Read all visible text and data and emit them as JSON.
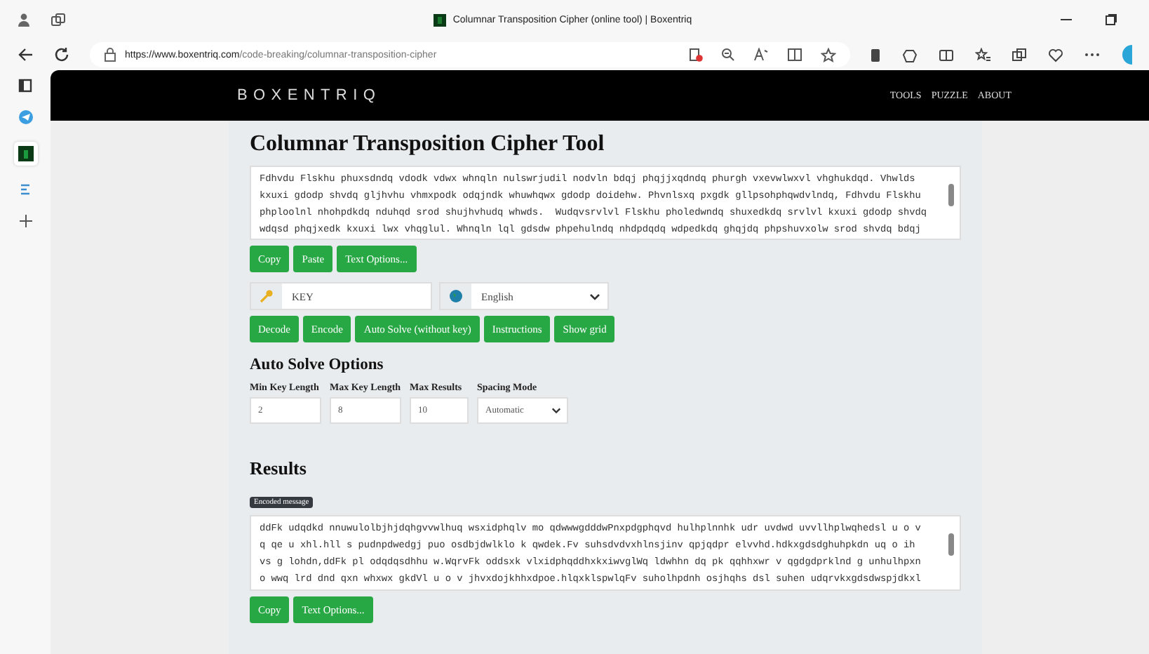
{
  "browser": {
    "tab_title": "Columnar Transposition Cipher (online tool) | Boxentriq",
    "url_host": "https://www.boxentriq.com",
    "url_path": "/code-breaking/columnar-transposition-cipher"
  },
  "header": {
    "logo": "BOXENTRIQ",
    "nav": [
      "TOOLS",
      "PUZZLE",
      "ABOUT"
    ]
  },
  "title": "Columnar Transposition Cipher Tool",
  "input_lines": [
    "Fdhvdu Flskhu phuxsdndq vdodk vdwx whnqln nulswrjudil nodvln bdqj phqjjxqdndq phurgh vxevwlwxvl vhghukdqd. Vhwlds",
    "kxuxi gdodp shvdq gljhvhu vhmxpodk odqjndk whuwhqwx gdodp doidehw. Phvnlsxq pxgdk gllpsohphqwdvlndq, Fdhvdu Flskhu",
    "phploolnl nhohpdkdq nduhqd srod shujhvhudq whwds.  Wudqvsrvlvl Flskhu pholedwndq shuxedkdq srvlvl kxuxi gdodp shvdq",
    "wdqsd phqjxedk kxuxi lwx vhqglul. Whnqln lql gdsdw phpehulndq nhdpdqdq wdpedkdq ghqjdq phpshuvxolw srod shvdq bdqj"
  ],
  "input_buttons": [
    "Copy",
    "Paste",
    "Text Options..."
  ],
  "key_field": {
    "value": "KEY"
  },
  "language_select": {
    "value": "English"
  },
  "action_buttons": [
    "Decode",
    "Encode",
    "Auto Solve (without key)",
    "Instructions",
    "Show grid"
  ],
  "auto_solve": {
    "heading": "Auto Solve Options",
    "fields": [
      {
        "label": "Min Key Length",
        "value": "2",
        "kind": "input"
      },
      {
        "label": "Max Key Length",
        "value": "8",
        "kind": "input"
      },
      {
        "label": "Max Results",
        "value": "10",
        "kind": "input"
      },
      {
        "label": "Spacing Mode",
        "value": "Automatic",
        "kind": "select"
      }
    ]
  },
  "results": {
    "heading": "Results",
    "badge": "Encoded message",
    "lines": [
      "ddFk udqdkd nnuwulolbjhjdqhgvvwlhuq wsxidphqlv mo qdwwwgdddwPnxpdgphqvd hulhplnnhk udr uvdwd uvvllhplwqhedsl u o v",
      "q qe u xhl.hll s pudnpdwedgj puo osdbjdwlklo k qwdek.Fv suhsdvdvxhlnsjinv qpjqdpr elvvhd.hdkxgdsdghuhpkdn uq o ih",
      "vs g lohdn,ddFk pl odqdqsdhhu w.WqrvFk oddsxk vlxidphqddhxkxiwvglWq ldwhhn dq pk qqhhxwr v qgdgdprklnd g unhulhpxn",
      "o wwq lrd dnd qxn whxwx gkdVl u o v jhvxdojkhhxdpoe.hlqxklspwlqFv suholhpdnh osjhqhs dsl suhen udqrvkxgdsdwspjdkxl"
    ],
    "buttons": [
      "Copy",
      "Text Options..."
    ]
  }
}
